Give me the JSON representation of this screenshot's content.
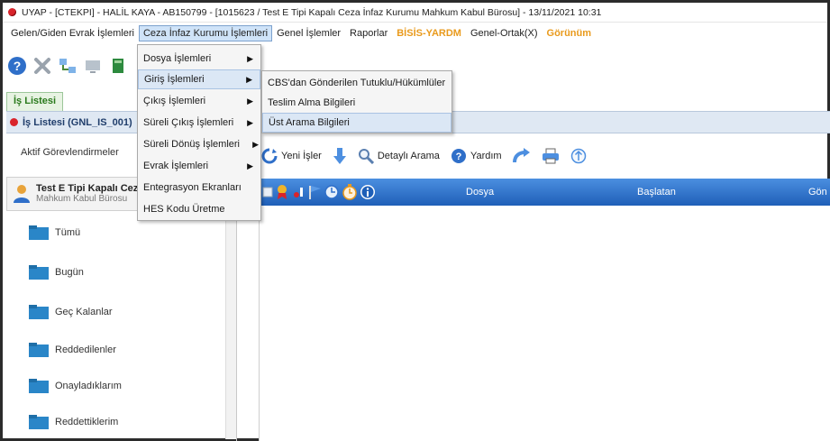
{
  "window": {
    "title": "UYAP - [CTEKPI] -  HALİL KAYA - AB150799 - [1015623 / Test E Tipi Kapalı Ceza İnfaz Kurumu Mahkum Kabul Bürosu] - 13/11/2021 10:31",
    "title_icon": "red-dot-icon"
  },
  "menubar": {
    "items": [
      {
        "label": "Gelen/Giden Evrak İşlemleri"
      },
      {
        "label": "Ceza İnfaz Kurumu İşlemleri"
      },
      {
        "label": "Genel İşlemler"
      },
      {
        "label": "Raporlar"
      },
      {
        "label": "BİSİS-YARDM"
      },
      {
        "label": "Genel-Ortak(X)"
      },
      {
        "label": "Görünüm"
      }
    ],
    "accent_color": "#e99a1c"
  },
  "main_dropdown": {
    "items": [
      {
        "label": "Dosya İşlemleri",
        "submenu": true
      },
      {
        "label": "Giriş İşlemleri",
        "submenu": true
      },
      {
        "label": "Çıkış İşlemleri",
        "submenu": true
      },
      {
        "label": "Süreli Çıkış İşlemleri",
        "submenu": true
      },
      {
        "label": "Süreli Dönüş İşlemleri",
        "submenu": true
      },
      {
        "label": "Evrak İşlemleri",
        "submenu": true
      },
      {
        "label": "Entegrasyon Ekranları",
        "submenu": false
      },
      {
        "label": "HES Kodu Üretme",
        "submenu": false
      }
    ]
  },
  "sub_dropdown": {
    "items": [
      {
        "label": "CBS'dan Gönderilen Tutuklu/Hükümlüler"
      },
      {
        "label": "Teslim Alma Bilgileri"
      },
      {
        "label": "Üst Arama Bilgileri"
      }
    ]
  },
  "left": {
    "tab_label": "İş Listesi",
    "panel_title": "İş Listesi (GNL_IS_001)",
    "aktif_label": "Aktif Görevlendirmeler",
    "unit_title": "Test E Tipi Kapalı Ceza İ",
    "unit_subtitle": "Mahkum Kabul Bürosu",
    "folders": [
      {
        "label": "Tümü"
      },
      {
        "label": "Bugün"
      },
      {
        "label": "Geç Kalanlar"
      },
      {
        "label": "Reddedilenler"
      },
      {
        "label": "Onayladıklarım"
      },
      {
        "label": "Reddettiklerim"
      }
    ]
  },
  "right_toolbar": {
    "yeni_isler": "Yeni İşler",
    "detayli_arama": "Detaylı Arama",
    "yardim": "Yardım"
  },
  "grid": {
    "columns": [
      "Dosya",
      "Başlatan",
      "Gön"
    ],
    "header_color": "#2f73cc"
  }
}
